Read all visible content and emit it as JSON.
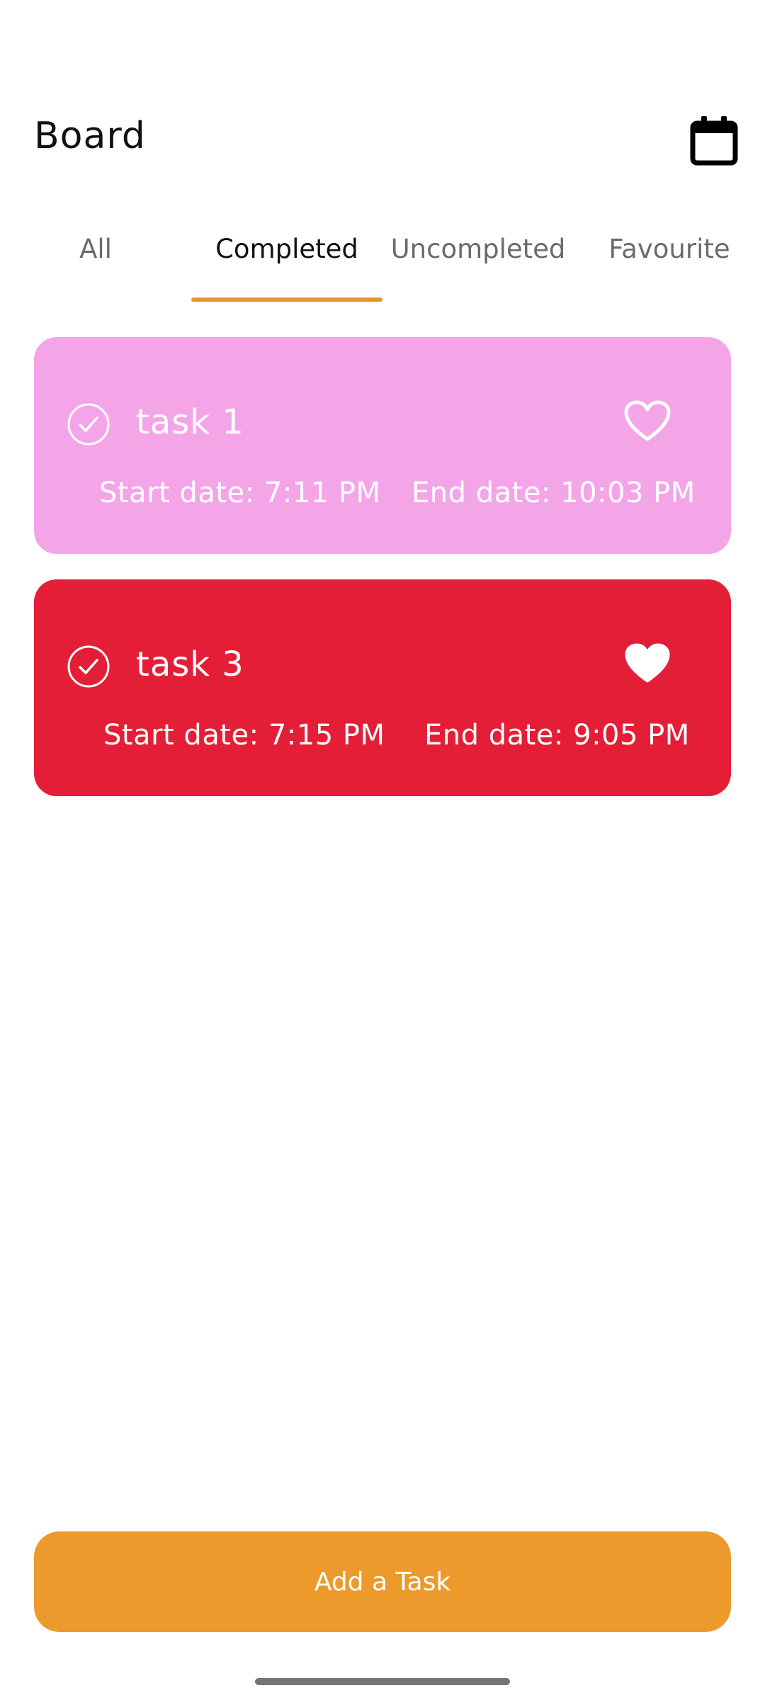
{
  "header": {
    "title": "Board",
    "calendar_icon": "calendar-icon"
  },
  "tabs": {
    "active_index": 1,
    "items": [
      {
        "label": "All"
      },
      {
        "label": "Completed"
      },
      {
        "label": "Uncompleted"
      },
      {
        "label": "Favourite"
      }
    ],
    "indicator_color": "#e3962e"
  },
  "tasks": [
    {
      "title": "task 1",
      "start": "Start date: 7:11 PM",
      "end": "End date: 10:03 PM",
      "completed": true,
      "favourite": false,
      "color": "#f4a5e8"
    },
    {
      "title": "task 3",
      "start": "Start date: 7:15 PM",
      "end": "End date: 9:05 PM",
      "completed": true,
      "favourite": true,
      "color": "#e41e36"
    }
  ],
  "actions": {
    "add_task_label": "Add a Task",
    "add_task_color": "#ec9a2c"
  }
}
